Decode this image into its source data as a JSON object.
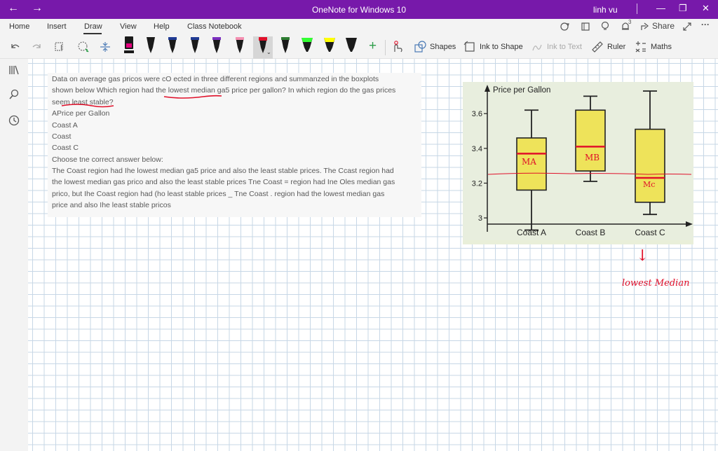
{
  "window": {
    "title": "OneNote for Windows 10",
    "user": "linh vu",
    "back_icon": "←",
    "forward_icon": "→",
    "minimize_icon": "—",
    "maximize_icon": "❐",
    "close_icon": "✕"
  },
  "ribbon": {
    "tabs": [
      {
        "label": "Home"
      },
      {
        "label": "Insert"
      },
      {
        "label": "Draw"
      },
      {
        "label": "View"
      },
      {
        "label": "Help"
      },
      {
        "label": "Class Notebook"
      }
    ],
    "active_tab": "Draw",
    "share_label": "Share",
    "notification_count": "3",
    "more_icon": "···"
  },
  "toolbar": {
    "shapes_label": "Shapes",
    "ink_to_shape_label": "Ink to Shape",
    "ink_to_text_label": "Ink to Text",
    "ruler_label": "Ruler",
    "maths_label": "Maths",
    "pens": [
      {
        "name": "pen-pink",
        "color": "#e6007e"
      },
      {
        "name": "pen-black-1",
        "color": "#1a1a1a"
      },
      {
        "name": "pen-black-2",
        "color": "#1a1a1a"
      },
      {
        "name": "pen-navy",
        "color": "#1f3a93"
      },
      {
        "name": "pen-purple",
        "color": "#7b2fbf"
      },
      {
        "name": "pen-pink-light",
        "color": "#f48fb1"
      },
      {
        "name": "pen-red",
        "color": "#e0102a"
      },
      {
        "name": "pen-green",
        "color": "#2e7d32"
      },
      {
        "name": "highlighter-green",
        "color": "#33ff33"
      },
      {
        "name": "highlighter-yellow",
        "color": "#ffff00"
      },
      {
        "name": "pen-black-3",
        "color": "#1a1a1a"
      }
    ]
  },
  "question": {
    "lines": [
      "Data on average gas pricos were cO ected in three different regions and summanzed in the boxplots",
      "shown below Which region had the lowest median ga5 price per gallon? In which region do the gas prices",
      "seem least stable?",
      "APrice per Gallon",
      "Coast A",
      "Coast",
      "Coast C",
      "Choose tne correct answer below:",
      "The Coast region had Ihe lowest median ga5 price and also the least stable prices. The Ccast region had",
      "the lowest median gas prico and also the least stable prices Tne Coast = region had Ine Oles median gas",
      "prico, but Ihe Coast region had (ho least stable prices _ Tne Coast . region had the lowest median gas",
      "price and also Ihe least stable pricos"
    ]
  },
  "chart_data": {
    "type": "boxplot",
    "ylabel": "Price per Gallon",
    "categories": [
      "Coast A",
      "Coast B",
      "Coast C"
    ],
    "yticks": [
      "3",
      "3.2",
      "3.4",
      "3.6"
    ],
    "ylim": [
      2.92,
      3.75
    ],
    "boxes": [
      {
        "category": "Coast A",
        "min": 2.93,
        "q1": 3.16,
        "median": 3.37,
        "q3": 3.46,
        "max": 3.62
      },
      {
        "category": "Coast B",
        "min": 3.21,
        "q1": 3.27,
        "median": 3.41,
        "q3": 3.62,
        "max": 3.7
      },
      {
        "category": "Coast C",
        "min": 3.02,
        "q1": 3.09,
        "median": 3.23,
        "q3": 3.51,
        "max": 3.73
      }
    ],
    "box_color": "#eee35a",
    "median_color": "#e0102a"
  },
  "annotations": {
    "median_a": "MA",
    "median_b": "MB",
    "median_c": "Mc",
    "lowest_median": "lowest Median",
    "arrow": "↓"
  }
}
